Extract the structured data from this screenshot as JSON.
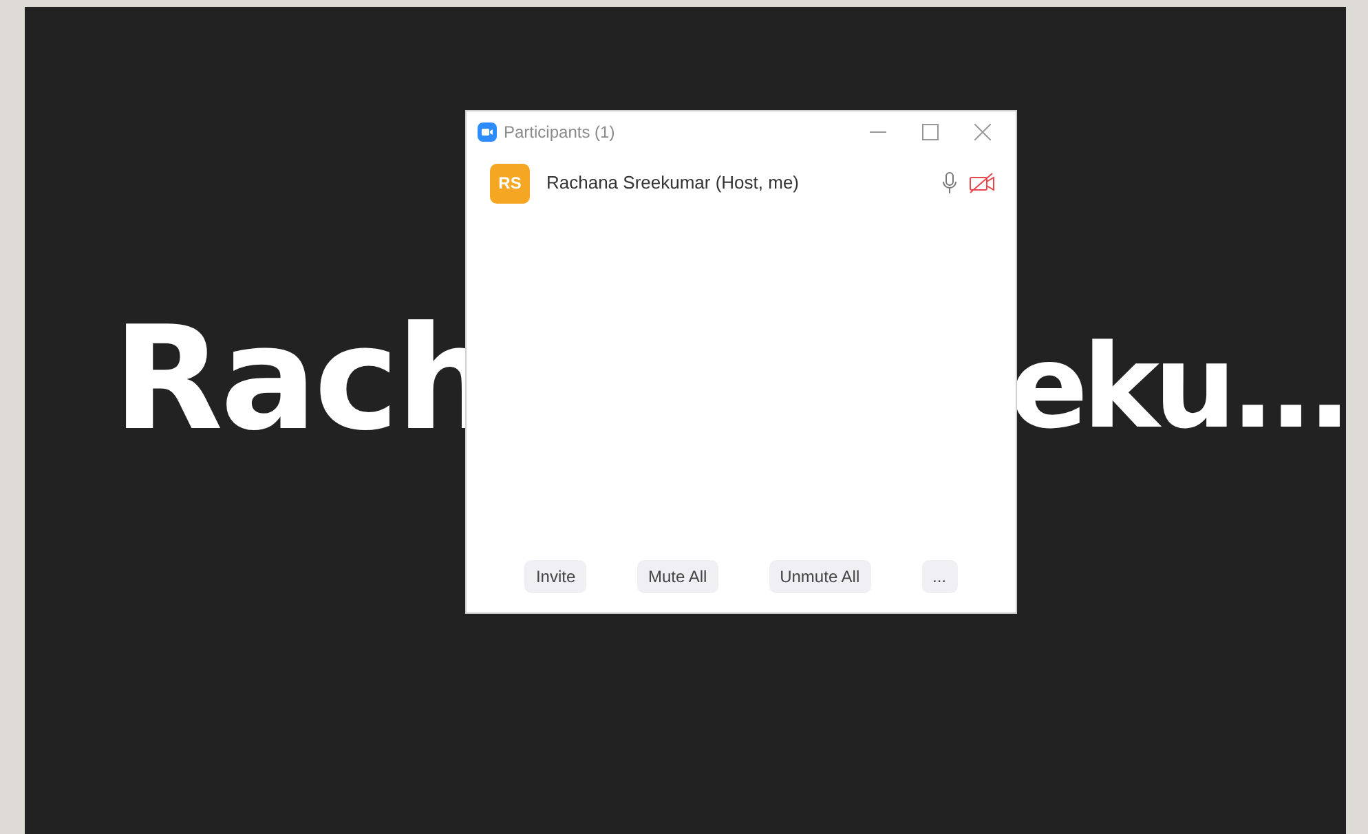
{
  "backdrop": {
    "name_left": "Rach",
    "name_right": "eku..."
  },
  "window": {
    "title": "Participants (1)"
  },
  "participants": [
    {
      "initials": "RS",
      "color": "#f5a623",
      "name": "Rachana Sreekumar (Host, me)",
      "muted": false,
      "video_off": true
    }
  ],
  "buttons": [
    {
      "label": "Invite"
    },
    {
      "label": "Mute All"
    },
    {
      "label": "Unmute All"
    },
    {
      "label": "..."
    }
  ]
}
